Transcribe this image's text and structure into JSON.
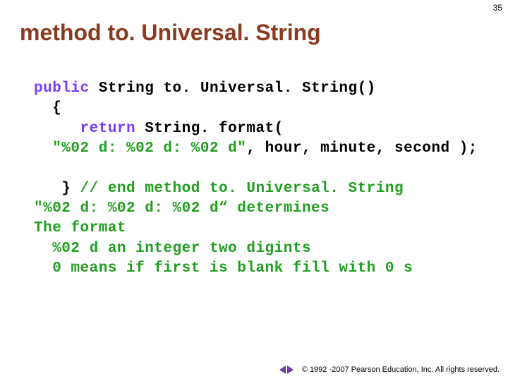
{
  "page_number": "35",
  "title": "method to. Universal. String",
  "code": {
    "l1_kw": "public",
    "l1_rest": " String to. Universal. String()",
    "l2": "  {",
    "l3_indent": "     ",
    "l3_kw": "return",
    "l3_rest": " String. format(",
    "l4_str": "  \"%02 d: %02 d: %02 d\"",
    "l4_rest": ", hour, minute, second );",
    "blank": "",
    "l5_close": "   } ",
    "l5_cmt": "// end method to. Universal. String",
    "exp1": "\"%02 d: %02 d: %02 d“ determines",
    "exp2": "The format",
    "exp3": "  %02 d an integer two digints",
    "exp4": "  0 means if first is blank fill with 0 s"
  },
  "footer_text": "1992 -2007 Pearson Education, Inc.  All rights reserved."
}
